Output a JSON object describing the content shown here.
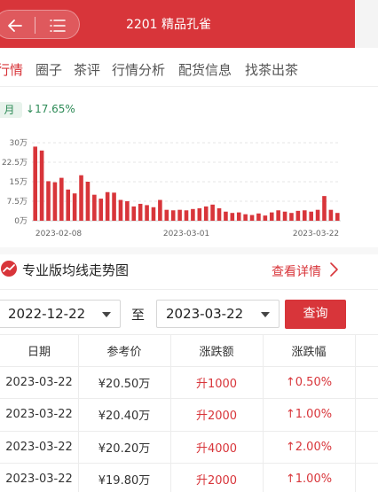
{
  "header": {
    "title": "2201 精品孔雀",
    "back_icon": "arrow-left-icon",
    "menu_icon": "menu-list-icon",
    "bg_color": "#d8353a"
  },
  "tabs": [
    {
      "label": "行情",
      "active": true
    },
    {
      "label": "圈子",
      "active": false
    },
    {
      "label": "茶评",
      "active": false
    },
    {
      "label": "行情分析",
      "active": false
    },
    {
      "label": "配货信息",
      "active": false
    },
    {
      "label": "找茶出茶",
      "active": false
    }
  ],
  "summary": {
    "period_label": "月",
    "change_arrow": "↓",
    "change_pct": "17.65%"
  },
  "chart_data": {
    "type": "bar",
    "y_ticks": [
      "30万",
      "22.5万",
      "15万",
      "7.5万",
      "0万"
    ],
    "x_ticks": [
      "2023-02-08",
      "2023-03-01",
      "2023-03-22"
    ],
    "ylim": [
      0,
      30
    ],
    "grid": true,
    "color": "#d8353a",
    "values": [
      28.5,
      27.0,
      15.2,
      14.8,
      16.5,
      12.0,
      10.5,
      17.5,
      15.0,
      10.0,
      8.5,
      11.0,
      10.8,
      8.0,
      7.5,
      5.5,
      6.5,
      6.0,
      5.2,
      8.0,
      4.2,
      4.0,
      4.2,
      4.0,
      4.5,
      4.8,
      5.5,
      6.2,
      4.8,
      3.5,
      3.0,
      3.2,
      2.5,
      2.2,
      2.8,
      2.0,
      3.2,
      4.0,
      3.5,
      3.0,
      3.8,
      4.0,
      3.5,
      4.2,
      9.5,
      4.2,
      3.0
    ]
  },
  "trend": {
    "title": "专业版均线走势图",
    "icon": "line-chart-icon",
    "detail_label": "查看详情",
    "detail_icon": "chevron-right-icon"
  },
  "filter": {
    "start_date": "2022-12-22",
    "to_label": "至",
    "end_date": "2023-03-22",
    "query_label": "查询"
  },
  "table": {
    "headers": [
      "日期",
      "参考价",
      "涨跌额",
      "涨跌幅"
    ],
    "rows": [
      {
        "date": "2023-03-22",
        "price": "¥20.50万",
        "change": "升1000",
        "pct": "↑0.50%"
      },
      {
        "date": "2023-03-22",
        "price": "¥20.40万",
        "change": "升2000",
        "pct": "↑1.00%"
      },
      {
        "date": "2023-03-22",
        "price": "¥20.20万",
        "change": "升4000",
        "pct": "↑2.00%"
      },
      {
        "date": "2023-03-22",
        "price": "¥19.80万",
        "change": "升2000",
        "pct": "↑1.00%"
      }
    ]
  }
}
